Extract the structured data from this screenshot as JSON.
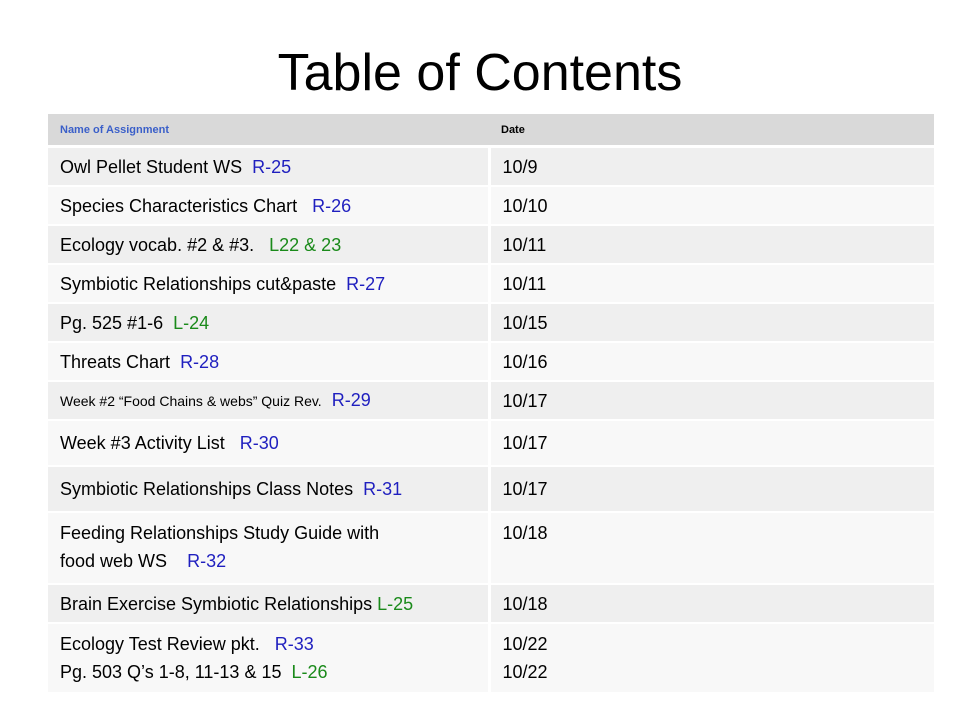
{
  "title": "Table of Contents",
  "columns": [
    "Name of Assignment",
    "Date"
  ],
  "colors": {
    "header_bg": "#d9d9d9",
    "header_name_color": "#3a5fc9",
    "ref_right": "#1f1fbf",
    "ref_left": "#1a8a1a",
    "row_odd": "#efefef",
    "row_even": "#f8f8f8"
  },
  "rows": [
    {
      "name": "Owl Pellet Student WS",
      "ref": "R-25",
      "date": "10/9"
    },
    {
      "name": "Species Characteristics Chart",
      "ref": "R-26",
      "date": "10/10"
    },
    {
      "name": "Ecology vocab. #2 & #3.",
      "ref": "L22 & 23",
      "date": "10/11"
    },
    {
      "name": "Symbiotic Relationships cut&paste",
      "ref": "R-27",
      "date": "10/11"
    },
    {
      "name": "Pg. 525 #1-6",
      "ref": "L-24",
      "date": "10/15"
    },
    {
      "name": "Threats Chart",
      "ref": "R-28",
      "date": "10/16"
    },
    {
      "name": "Week #2 “Food Chains & webs” Quiz Rev.",
      "ref": "R-29",
      "date": "10/17"
    },
    {
      "name": "Week #3 Activity List",
      "ref": "R-30",
      "date": "10/17"
    },
    {
      "name": "Symbiotic Relationships Class Notes",
      "ref": "R-31",
      "date": "10/17"
    },
    {
      "name_line1": "Feeding Relationships Study Guide with",
      "name_line2": "food web WS",
      "ref": "R-32",
      "date": "10/18"
    },
    {
      "name": "Brain Exercise Symbiotic Relationships",
      "ref": "L-25",
      "date": "10/18"
    },
    {
      "name_line1": "Ecology Test Review pkt.",
      "ref1": "R-33",
      "date1": "10/22",
      "name_line2": "Pg. 503 Q’s 1-8, 11-13 & 15",
      "ref2": "L-26",
      "date2": "10/22"
    }
  ]
}
